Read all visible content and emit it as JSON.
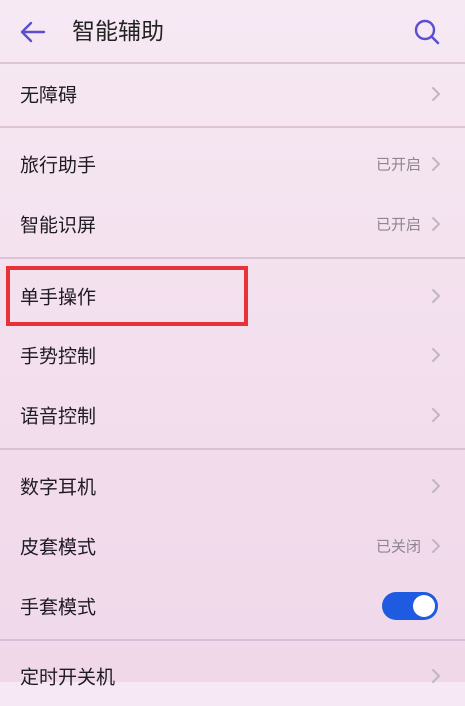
{
  "header": {
    "title": "智能辅助",
    "back_icon": "back-arrow-icon",
    "search_icon": "search-icon"
  },
  "items": [
    {
      "label": "无障碍",
      "status": "",
      "control": "chevron"
    },
    {
      "label": "旅行助手",
      "status": "已开启",
      "control": "chevron"
    },
    {
      "label": "智能识屏",
      "status": "已开启",
      "control": "chevron"
    },
    {
      "label": "单手操作",
      "status": "",
      "control": "chevron",
      "highlighted": true
    },
    {
      "label": "手势控制",
      "status": "",
      "control": "chevron"
    },
    {
      "label": "语音控制",
      "status": "",
      "control": "chevron"
    },
    {
      "label": "数字耳机",
      "status": "",
      "control": "chevron"
    },
    {
      "label": "皮套模式",
      "status": "已关闭",
      "control": "chevron"
    },
    {
      "label": "手套模式",
      "status": "",
      "control": "toggle",
      "toggle_on": true
    },
    {
      "label": "定时开关机",
      "status": "",
      "control": "chevron"
    }
  ],
  "colors": {
    "accent": "#1f5be0",
    "highlight": "#e8323a",
    "icon": "#5a4fd0"
  }
}
